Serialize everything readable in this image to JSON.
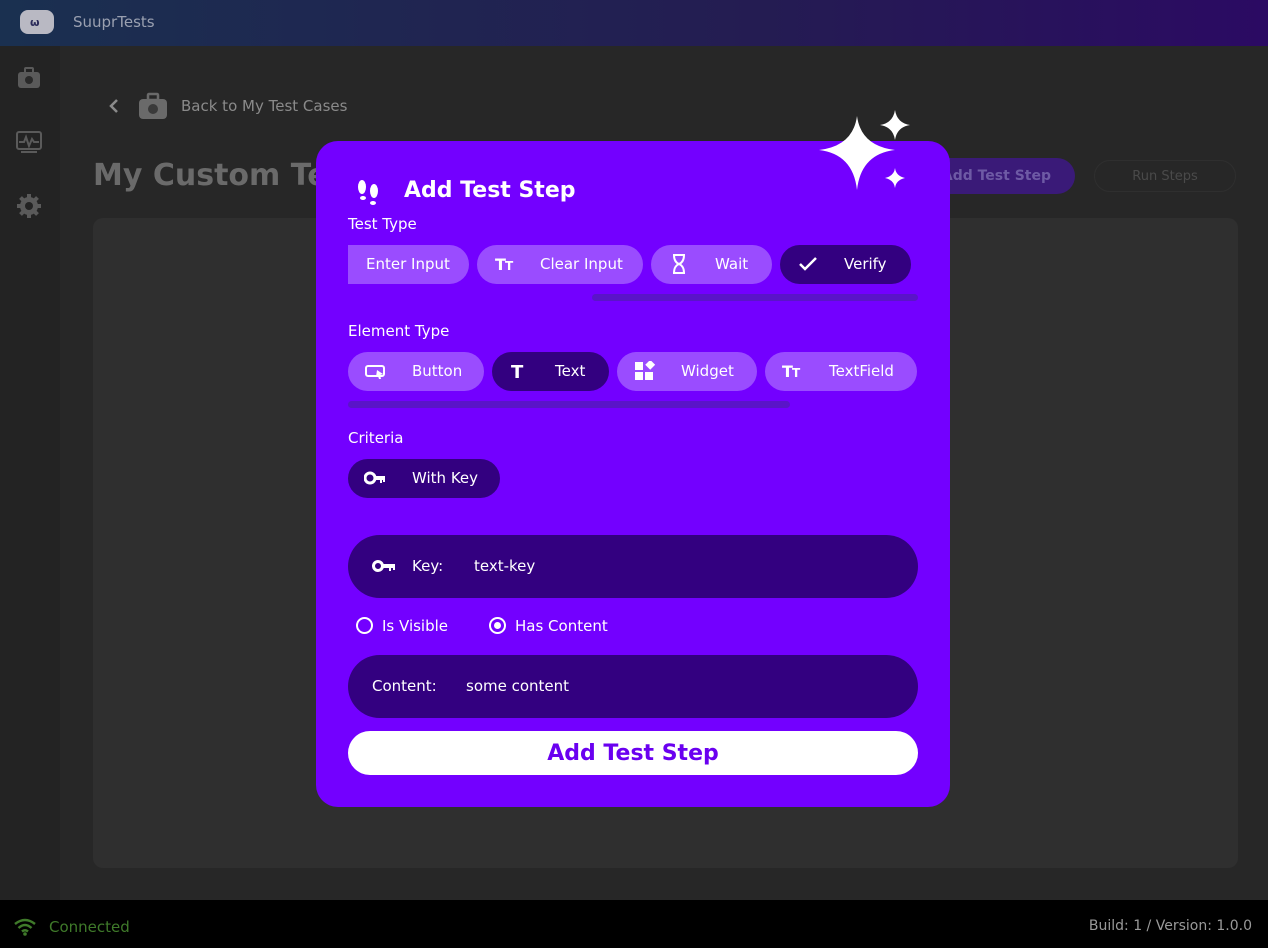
{
  "app": {
    "title": "SuuprTests"
  },
  "sidebar": {
    "items": [
      "test-cases-icon",
      "monitor-icon",
      "settings-icon"
    ]
  },
  "header": {
    "back_label": "Back to My Test Cases",
    "page_title": "My Custom Test",
    "add_step_label": "Add Test Step",
    "run_label": "Run Steps"
  },
  "modal": {
    "title": "Add Test Step",
    "test_type": {
      "label": "Test Type",
      "options": [
        "Enter Input",
        "Clear Input",
        "Wait",
        "Verify"
      ],
      "selected": "Verify"
    },
    "element_type": {
      "label": "Element Type",
      "options": [
        "Button",
        "Text",
        "Widget",
        "TextField"
      ],
      "selected": "Text"
    },
    "criteria": {
      "label": "Criteria",
      "options": [
        "With Key"
      ],
      "selected": "With Key"
    },
    "key_field": {
      "label": "Key:",
      "value": "text-key"
    },
    "verify_options": {
      "options": [
        "Is Visible",
        "Has Content"
      ],
      "selected": "Has Content"
    },
    "content_field": {
      "label": "Content:",
      "value": "some content"
    },
    "submit_label": "Add Test Step"
  },
  "footer": {
    "status": "Connected",
    "build": "Build: 1 / Version: 1.0.0"
  },
  "colors": {
    "modal_bg": "#7300ff",
    "chip": "#9a4cff",
    "chip_selected": "#330080",
    "connected": "#3f7a2a"
  }
}
